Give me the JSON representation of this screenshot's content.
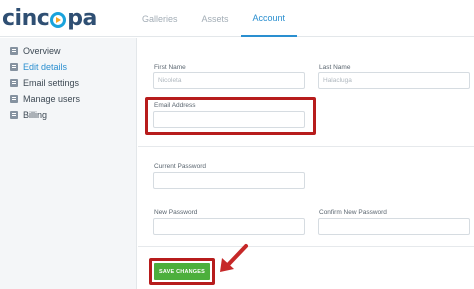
{
  "logo": {
    "text_before": "cinc",
    "text_after": "pa"
  },
  "topnav": [
    {
      "label": "Galleries"
    },
    {
      "label": "Assets"
    },
    {
      "label": "Account"
    }
  ],
  "sidebar": {
    "items": [
      {
        "label": "Overview",
        "icon": "overview-icon"
      },
      {
        "label": "Edit details",
        "icon": "edit-icon"
      },
      {
        "label": "Email settings",
        "icon": "email-icon"
      },
      {
        "label": "Manage users",
        "icon": "users-icon"
      },
      {
        "label": "Billing",
        "icon": "billing-icon"
      }
    ]
  },
  "form": {
    "first_name": {
      "label": "First Name",
      "value": "Nicoleta"
    },
    "last_name": {
      "label": "Last Name",
      "value": "Halacluga"
    },
    "email": {
      "label": "Email Address",
      "value": ""
    },
    "current_password": {
      "label": "Current Password",
      "value": ""
    },
    "new_password": {
      "label": "New Password",
      "value": ""
    },
    "confirm_password": {
      "label": "Confirm New Password",
      "value": ""
    },
    "save_label": "SAVE CHANGES"
  },
  "colors": {
    "accent": "#2a8fd0",
    "highlight": "#b71c1c",
    "save": "#4caf3c"
  }
}
